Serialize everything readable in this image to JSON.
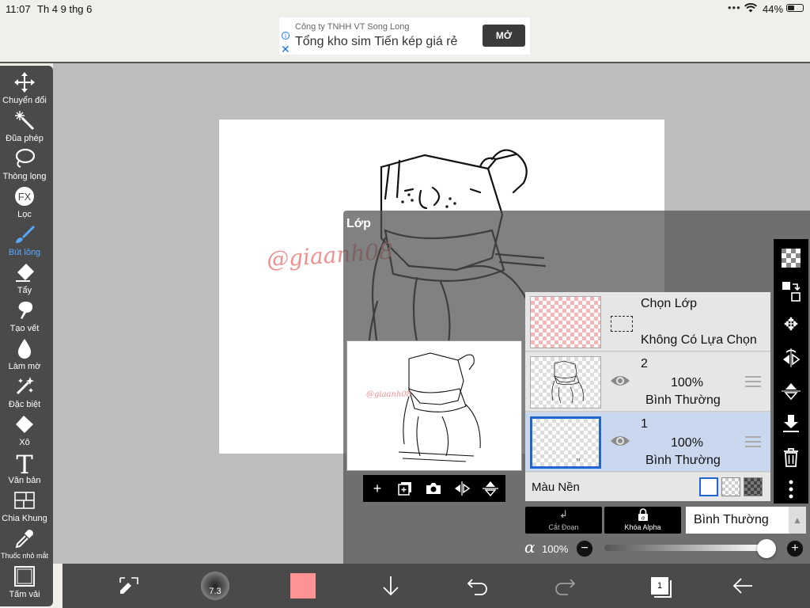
{
  "status_bar": {
    "time": "11:07",
    "date": "Th 4 9 thg 6",
    "battery": "44%",
    "battery_level": 0.44
  },
  "ad": {
    "company": "Công ty TNHH VT Song Long",
    "headline": "Tổng kho sim Tiến kép giá rẻ",
    "button": "MỞ"
  },
  "canvas": {
    "watermark": "@giaanh08"
  },
  "toolbar": {
    "items": [
      {
        "label": "Chuyển đổi",
        "icon": "move-icon"
      },
      {
        "label": "Đũa phép",
        "icon": "magic-wand-icon"
      },
      {
        "label": "Thòng lọng",
        "icon": "lasso-icon"
      },
      {
        "label": "Lọc",
        "icon": "fx-icon"
      },
      {
        "label": "Bút lông",
        "icon": "brush-icon",
        "active": true
      },
      {
        "label": "Tẩy",
        "icon": "eraser-icon"
      },
      {
        "label": "Tạo vết",
        "icon": "smudge-icon"
      },
      {
        "label": "Làm mờ",
        "icon": "blur-icon"
      },
      {
        "label": "Đặc biệt",
        "icon": "special-icon"
      },
      {
        "label": "Xô",
        "icon": "bucket-icon"
      },
      {
        "label": "Văn bản",
        "icon": "text-icon"
      },
      {
        "label": "Chia Khung",
        "icon": "frame-divider-icon"
      },
      {
        "label": "Thuốc nhỏ mắt",
        "icon": "eyedropper-icon"
      },
      {
        "label": "Tấm vải",
        "icon": "canvas-icon"
      }
    ]
  },
  "layer_panel": {
    "title": "Lớp",
    "selection_layer": {
      "title": "Chọn Lớp",
      "subtitle": "Không Có Lựa Chọn"
    },
    "layers": [
      {
        "name": "2",
        "opacity": "100%",
        "blend": "Bình Thường",
        "selected": false
      },
      {
        "name": "1",
        "opacity": "100%",
        "blend": "Bình Thường",
        "selected": true
      }
    ],
    "background": {
      "label": "Màu Nền"
    },
    "clip_label": "Cắt Đoạn",
    "alpha_lock_label": "Khóa Alpha",
    "blend_mode": "Bình Thường",
    "alpha_symbol": "α",
    "opacity_value": "100%",
    "opacity_level": 1.0
  },
  "bottom_bar": {
    "brush_size": "7.3",
    "color": "#ff9393",
    "layer_count": "1"
  },
  "colors": {
    "toolbar_bg": "#4a4a4a",
    "active_tool": "#5aa8ff",
    "selected_layer": "#c9d7ef",
    "selected_border": "#1e66d0",
    "canvas_bg": "#bdbdbd"
  }
}
